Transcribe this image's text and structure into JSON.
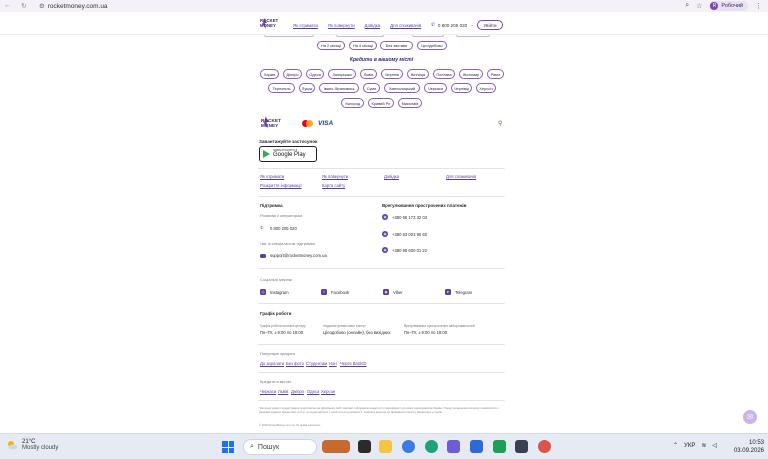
{
  "browser": {
    "url": "rocketmoney.com.ua",
    "profile_initial": "R",
    "profile_label": "Робочий"
  },
  "header": {
    "logo_line1": "ROCKET",
    "logo_line2": "MONEY",
    "nav": [
      "Як отримати",
      "Як повернути",
      "Довідка",
      "Для споживачів"
    ],
    "phone": "0 800 205 020",
    "login_label": "Увійти"
  },
  "top_pills": [
    "На 2 місяці",
    "На 4 місяці",
    "Без застави",
    "Цілодобово"
  ],
  "cities": {
    "title": "Кредити в вашому місті",
    "row1": [
      "Харків",
      "Дніпро",
      "Одеса",
      "Запоріжжя",
      "Львів",
      "Чернігів",
      "Вінниця",
      "Полтава",
      "Житомир",
      "Рівне"
    ],
    "row2": [
      "Тернопіль",
      "Луцьк",
      "Івано-Франківськ",
      "Суми",
      "Хмельницький",
      "Черкаси",
      "Чернівці",
      "Херсон"
    ],
    "row3": [
      "Ужгород",
      "Кривий Ріг",
      "Миколаїв"
    ]
  },
  "footer": {
    "visa": "VISA",
    "download_label": "Завантажуйте застосунок",
    "gplay_small": "Завантажити з",
    "gplay_big": "Google Play",
    "links": {
      "how_get": "Як отримати",
      "how_return": "Як повернути",
      "help": "Довідка",
      "consumers": "Для споживачів",
      "disclosure": "Розкриття інформації",
      "sitemap": "Карта сайту"
    },
    "support": {
      "title": "Підтримка",
      "operator_label": "Розмова з оператором",
      "operator_phone": "0 800 205 020",
      "email_label": "Чат зі спеціалістом підтримки",
      "email": "support@rocketmoney.com.ua"
    },
    "overdue": {
      "title": "Врегулювання прострочених платежів",
      "phones": [
        "+380 68 173 32 03",
        "+380 63 003 90 60",
        "+380 68 600 01 22"
      ]
    },
    "social": {
      "title": "Соціальні мережі",
      "items": [
        "Instagram",
        "Facebook",
        "Viber",
        "Telegram"
      ]
    },
    "hours": {
      "title": "Графік роботи",
      "col1_label": "Графік роботи контакт-центру",
      "col1_value": "Пн–Пт, з 9:00 по 18:00",
      "col2_label": "Надання фінансових послуг",
      "col2_value": "Цілодобово (онлайн), без вихідних",
      "col3_label": "Врегулювання прострочених заборгованостей",
      "col3_value": "Пн–Пт, з 9:00 по 18:00"
    },
    "popular": {
      "title": "Популярні кредити",
      "items": [
        "До зарплати",
        "Без фото",
        "Студентам",
        "Нон",
        "Через BankID"
      ]
    },
    "city_credits": {
      "title": "Кредити в містах",
      "items": [
        "Черкаси",
        "Львів",
        "Дніпро",
        "Одеса",
        "Херсон"
      ]
    },
    "fine_print": "*Детальні умови з кредитування представлені на офіційному сайті компанії. Інформація надається у відповідності до вимог законодавства України. Перед укладанням договору ознайомтеся з умовами надання фінансових послуг та переконайтеся у своїй платоспроможності. Компанія внесена до Державного реєстру фінансових установ.",
    "copyright": "© 2026 RocketMoney.com.ua. Усі права захищено."
  },
  "taskbar": {
    "temp": "21°C",
    "weather": "Mostly cloudy",
    "search": "Пошук",
    "lang": "УКР",
    "time": "10:53",
    "date": "03.09.2026"
  }
}
